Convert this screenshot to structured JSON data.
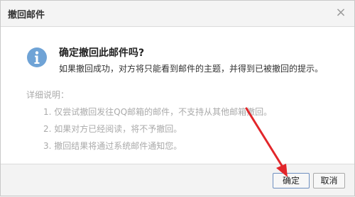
{
  "dialog": {
    "title": "撤回邮件",
    "close_symbol": "×",
    "headline": "确定撤回此邮件吗?",
    "message": "如果撤回成功，对方将只能看到邮件的主题，并得到已被撤回的提示。",
    "details_label": "详细说明：",
    "details": [
      "1. 仅尝试撤回发往QQ邮箱的邮件，不支持从其他邮箱撤回。",
      "2. 如果对方已经阅读，将不予撤回。",
      "3. 撤回结果将通过系统邮件通知您。"
    ],
    "ok_label": "确定",
    "cancel_label": "取消"
  },
  "colors": {
    "info_icon": "#6fa3d6",
    "annotation_arrow": "#e2262a"
  },
  "icons": [
    "info-icon",
    "close-icon"
  ]
}
